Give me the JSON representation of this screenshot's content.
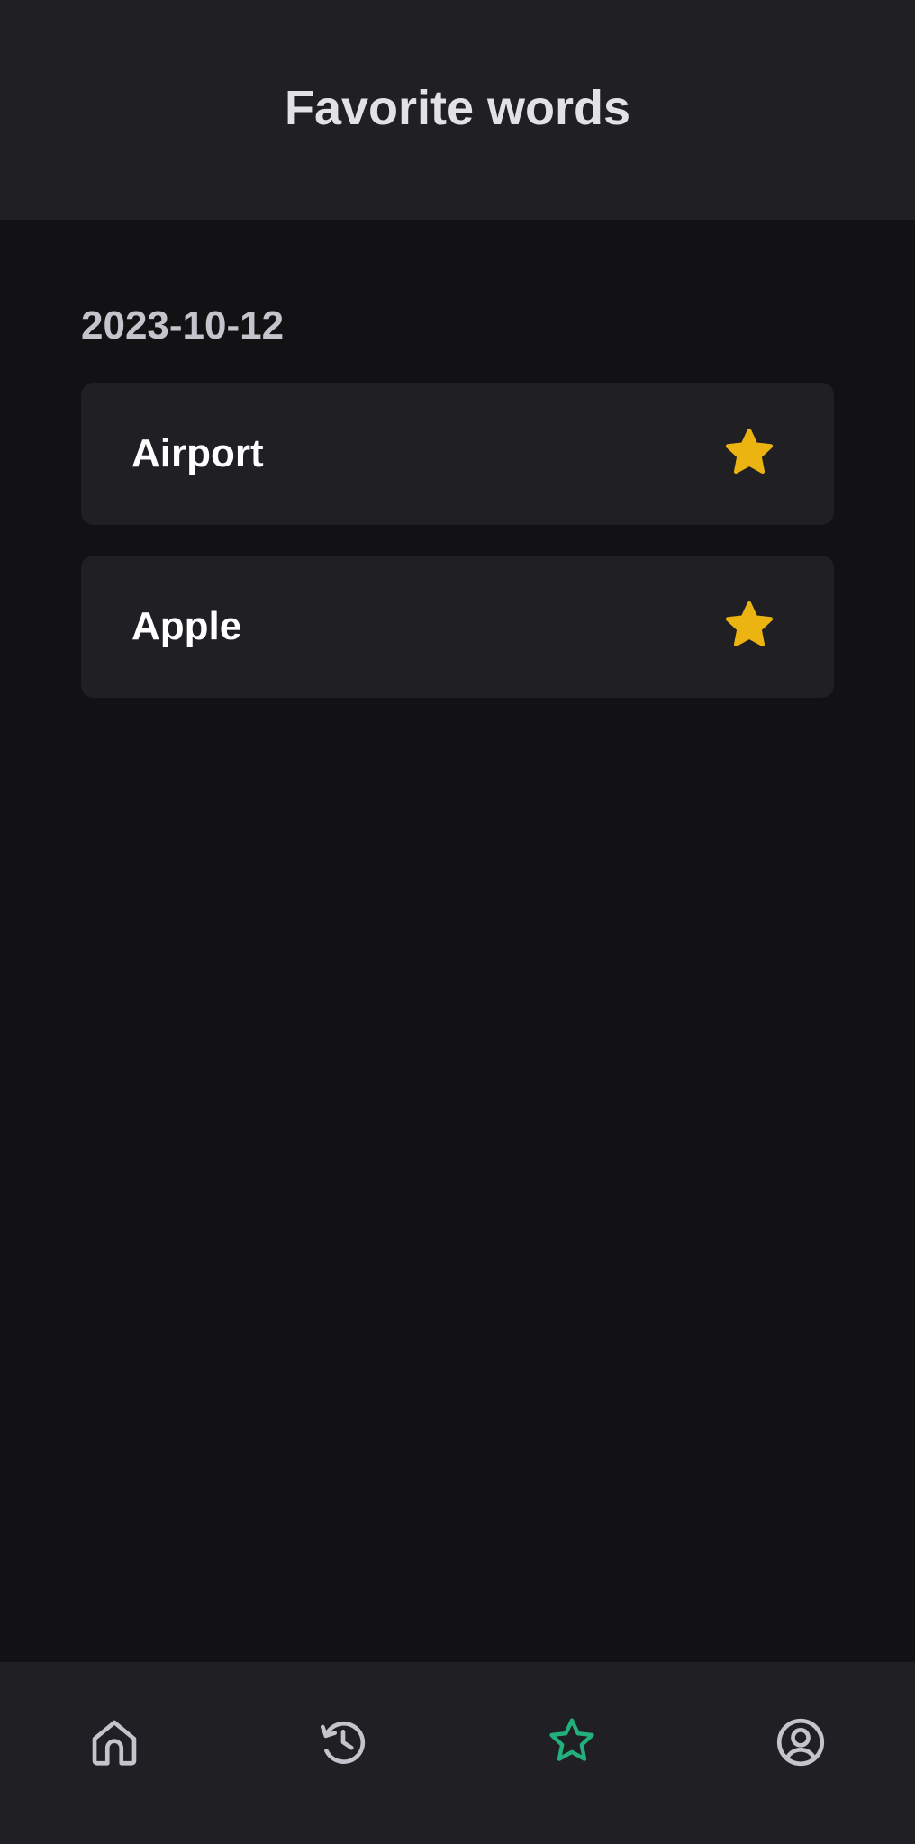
{
  "header": {
    "title": "Favorite words"
  },
  "favorites": {
    "groups": [
      {
        "date": "2023-10-12",
        "words": [
          {
            "word": "Airport",
            "favorited": true
          },
          {
            "word": "Apple",
            "favorited": true
          }
        ]
      }
    ]
  },
  "tabbar": {
    "tabs": [
      {
        "icon": "home-icon",
        "active": false
      },
      {
        "icon": "history-icon",
        "active": false
      },
      {
        "icon": "star-icon",
        "active": true
      },
      {
        "icon": "user-circle-icon",
        "active": false
      }
    ]
  },
  "colors": {
    "background": "#121214",
    "surface": "#202024",
    "star": "#ecb411",
    "active_tab": "#22b07d",
    "inactive_tab": "#c4c4cc"
  }
}
